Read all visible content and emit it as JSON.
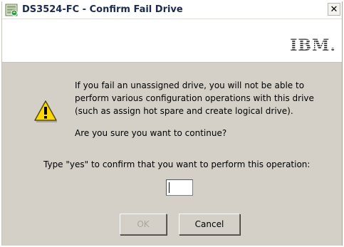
{
  "window": {
    "title": "DS3524-FC - Confirm Fail Drive",
    "close_glyph": "✕"
  },
  "brand": {
    "logo_text": "IBM."
  },
  "dialog": {
    "message_lines": [
      "If you fail an unassigned drive, you will not be able to",
      "perform various configuration operations with this drive",
      "(such as assign hot spare and create logical drive)."
    ],
    "question": "Are you sure you want to continue?",
    "prompt": "Type \"yes\" to confirm that you want to perform this operation:",
    "confirm_input": {
      "value": ""
    }
  },
  "buttons": {
    "ok_label": "OK",
    "ok_enabled": false,
    "cancel_label": "Cancel"
  },
  "icons": {
    "app": "storage-manager-icon",
    "warning": "warning-icon",
    "close": "close-icon"
  },
  "colors": {
    "dialog_background": "#d4d0c8",
    "warning_fill": "#ffd800",
    "disabled_text": "#a9a69f"
  }
}
